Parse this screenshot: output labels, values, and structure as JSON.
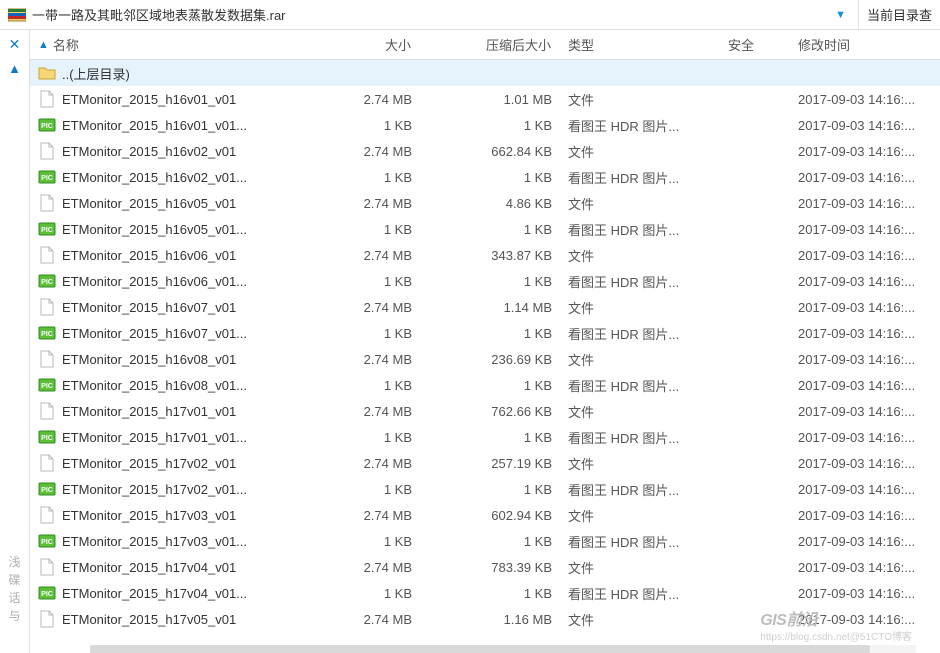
{
  "titlebar": {
    "title": "一带一路及其毗邻区域地表蒸散发数据集.rar",
    "right_label": "当前目录查"
  },
  "columns": {
    "name": "名称",
    "size": "大小",
    "packed": "压缩后大小",
    "type": "类型",
    "safe": "安全",
    "mtime": "修改时间"
  },
  "up_dir_label": "..(上层目录)",
  "rows": [
    {
      "icon": "file",
      "name": "ETMonitor_2015_h16v01_v01",
      "size": "2.74 MB",
      "packed": "1.01 MB",
      "type": "文件",
      "mtime": "2017-09-03 14:16:..."
    },
    {
      "icon": "pic",
      "name": "ETMonitor_2015_h16v01_v01...",
      "size": "1 KB",
      "packed": "1 KB",
      "type": "看图王 HDR 图片...",
      "mtime": "2017-09-03 14:16:..."
    },
    {
      "icon": "file",
      "name": "ETMonitor_2015_h16v02_v01",
      "size": "2.74 MB",
      "packed": "662.84 KB",
      "type": "文件",
      "mtime": "2017-09-03 14:16:..."
    },
    {
      "icon": "pic",
      "name": "ETMonitor_2015_h16v02_v01...",
      "size": "1 KB",
      "packed": "1 KB",
      "type": "看图王 HDR 图片...",
      "mtime": "2017-09-03 14:16:..."
    },
    {
      "icon": "file",
      "name": "ETMonitor_2015_h16v05_v01",
      "size": "2.74 MB",
      "packed": "4.86 KB",
      "type": "文件",
      "mtime": "2017-09-03 14:16:..."
    },
    {
      "icon": "pic",
      "name": "ETMonitor_2015_h16v05_v01...",
      "size": "1 KB",
      "packed": "1 KB",
      "type": "看图王 HDR 图片...",
      "mtime": "2017-09-03 14:16:..."
    },
    {
      "icon": "file",
      "name": "ETMonitor_2015_h16v06_v01",
      "size": "2.74 MB",
      "packed": "343.87 KB",
      "type": "文件",
      "mtime": "2017-09-03 14:16:..."
    },
    {
      "icon": "pic",
      "name": "ETMonitor_2015_h16v06_v01...",
      "size": "1 KB",
      "packed": "1 KB",
      "type": "看图王 HDR 图片...",
      "mtime": "2017-09-03 14:16:..."
    },
    {
      "icon": "file",
      "name": "ETMonitor_2015_h16v07_v01",
      "size": "2.74 MB",
      "packed": "1.14 MB",
      "type": "文件",
      "mtime": "2017-09-03 14:16:..."
    },
    {
      "icon": "pic",
      "name": "ETMonitor_2015_h16v07_v01...",
      "size": "1 KB",
      "packed": "1 KB",
      "type": "看图王 HDR 图片...",
      "mtime": "2017-09-03 14:16:..."
    },
    {
      "icon": "file",
      "name": "ETMonitor_2015_h16v08_v01",
      "size": "2.74 MB",
      "packed": "236.69 KB",
      "type": "文件",
      "mtime": "2017-09-03 14:16:..."
    },
    {
      "icon": "pic",
      "name": "ETMonitor_2015_h16v08_v01...",
      "size": "1 KB",
      "packed": "1 KB",
      "type": "看图王 HDR 图片...",
      "mtime": "2017-09-03 14:16:..."
    },
    {
      "icon": "file",
      "name": "ETMonitor_2015_h17v01_v01",
      "size": "2.74 MB",
      "packed": "762.66 KB",
      "type": "文件",
      "mtime": "2017-09-03 14:16:..."
    },
    {
      "icon": "pic",
      "name": "ETMonitor_2015_h17v01_v01...",
      "size": "1 KB",
      "packed": "1 KB",
      "type": "看图王 HDR 图片...",
      "mtime": "2017-09-03 14:16:..."
    },
    {
      "icon": "file",
      "name": "ETMonitor_2015_h17v02_v01",
      "size": "2.74 MB",
      "packed": "257.19 KB",
      "type": "文件",
      "mtime": "2017-09-03 14:16:..."
    },
    {
      "icon": "pic",
      "name": "ETMonitor_2015_h17v02_v01...",
      "size": "1 KB",
      "packed": "1 KB",
      "type": "看图王 HDR 图片...",
      "mtime": "2017-09-03 14:16:..."
    },
    {
      "icon": "file",
      "name": "ETMonitor_2015_h17v03_v01",
      "size": "2.74 MB",
      "packed": "602.94 KB",
      "type": "文件",
      "mtime": "2017-09-03 14:16:..."
    },
    {
      "icon": "pic",
      "name": "ETMonitor_2015_h17v03_v01...",
      "size": "1 KB",
      "packed": "1 KB",
      "type": "看图王 HDR 图片...",
      "mtime": "2017-09-03 14:16:..."
    },
    {
      "icon": "file",
      "name": "ETMonitor_2015_h17v04_v01",
      "size": "2.74 MB",
      "packed": "783.39 KB",
      "type": "文件",
      "mtime": "2017-09-03 14:16:..."
    },
    {
      "icon": "pic",
      "name": "ETMonitor_2015_h17v04_v01...",
      "size": "1 KB",
      "packed": "1 KB",
      "type": "看图王 HDR 图片...",
      "mtime": "2017-09-03 14:16:..."
    },
    {
      "icon": "file",
      "name": "ETMonitor_2015_h17v05_v01",
      "size": "2.74 MB",
      "packed": "1.16 MB",
      "type": "文件",
      "mtime": "2017-09-03 14:16:..."
    }
  ],
  "watermark": {
    "main": "GIS前沿",
    "sub": "https://blog.csdn.net@51CTO博客"
  },
  "side_chars": [
    "浅",
    "碟",
    "话",
    "与"
  ]
}
